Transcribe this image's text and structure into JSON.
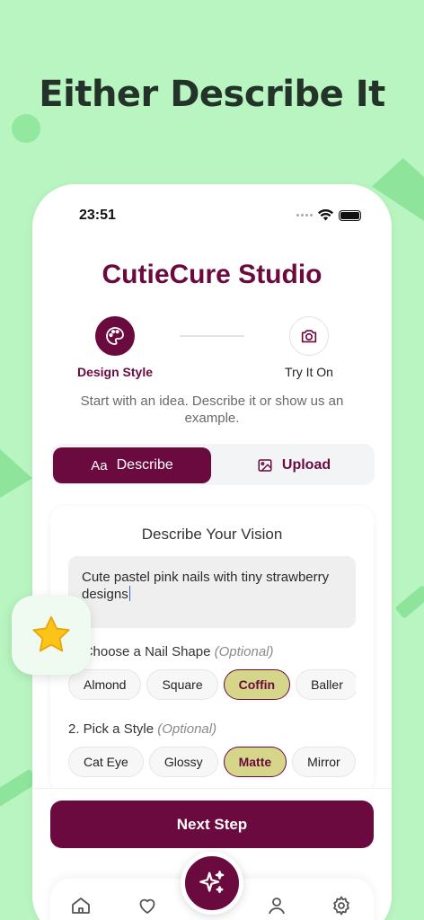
{
  "headline": "Either Describe It",
  "status": {
    "time": "23:51"
  },
  "app": {
    "title": "CutieCure Studio"
  },
  "steps": [
    {
      "label": "Design Style",
      "icon": "palette-icon",
      "active": true
    },
    {
      "label": "Try It On",
      "icon": "camera-icon",
      "active": false
    }
  ],
  "subtitle": "Start with an idea. Describe it or show us an example.",
  "tabs": {
    "describe": "Describe",
    "describe_icon": "Aa",
    "upload": "Upload"
  },
  "vision": {
    "title": "Describe Your Vision",
    "text": "Cute pastel pink nails with tiny strawberry designs",
    "shape_label": "Choose a Nail Shape",
    "shape_label_prefix": "1. ",
    "optional": "(Optional)",
    "shapes": [
      "Almond",
      "Square",
      "Coffin",
      "Baller"
    ],
    "selected_shape": "Coffin",
    "style_label": "2. Pick a Style",
    "styles": [
      "Cat Eye",
      "Glossy",
      "Matte",
      "Mirror"
    ],
    "selected_style": "Matte"
  },
  "next_button": "Next Step",
  "nav": [
    "home-icon",
    "heart-icon",
    "sparkles-icon",
    "profile-icon",
    "settings-icon"
  ],
  "colors": {
    "accent": "#6b0a3f",
    "background": "#b8f5c0",
    "chip_selected": "#d5d68a"
  }
}
